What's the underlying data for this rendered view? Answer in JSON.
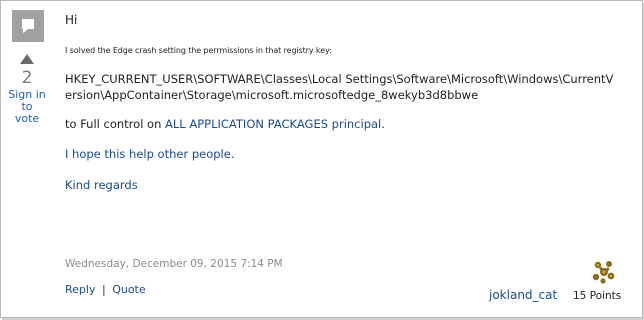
{
  "vote": {
    "count": "2",
    "signin_label": "Sign in\nto vote"
  },
  "message": {
    "greeting": "Hi",
    "intro": "I solved the Edge crash  setting the perrmissions in that registry key:",
    "registry_key": "HKEY_CURRENT_USER\\SOFTWARE\\Classes\\Local Settings\\Software\\Microsoft\\Windows\\CurrentVersion\\AppContainer\\Storage\\microsoft.microsoftedge_8wekyb3d8bbwe",
    "full_control_prefix": "to Full control on ",
    "full_control_link": "ALL APPLICATION PACKAGES  principal",
    "full_control_suffix": ".",
    "hope": "I hope this help other people.",
    "regards": "Kind regards"
  },
  "footer": {
    "date": "Wednesday, December 09, 2015 7:14 PM",
    "reply_label": "Reply",
    "separator": "|",
    "quote_label": "Quote",
    "user_name": "jokland_cat",
    "points": "15 Points"
  },
  "colors": {
    "link": "#1a4a8a",
    "signin": "#2460b0",
    "muted": "#8a8a8a",
    "avatar_gold": "#8a6d1e"
  }
}
